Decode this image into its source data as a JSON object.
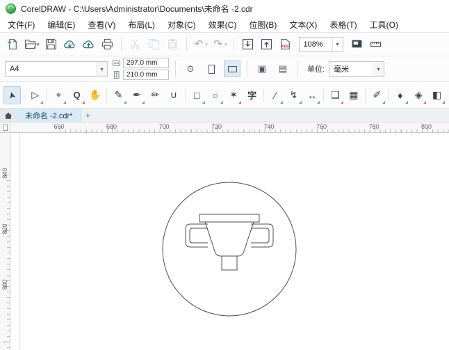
{
  "window": {
    "title": "CorelDRAW - C:\\Users\\Administrator\\Documents\\未命名 -2.cdr"
  },
  "menu": {
    "items": [
      {
        "id": "file",
        "label": "文件(F)"
      },
      {
        "id": "edit",
        "label": "编辑(E)"
      },
      {
        "id": "view",
        "label": "查看(V)"
      },
      {
        "id": "layout",
        "label": "布局(L)"
      },
      {
        "id": "object",
        "label": "对象(C)"
      },
      {
        "id": "effects",
        "label": "效果(C)"
      },
      {
        "id": "bitmaps",
        "label": "位图(B)"
      },
      {
        "id": "text",
        "label": "文本(X)"
      },
      {
        "id": "table",
        "label": "表格(T)"
      },
      {
        "id": "tools",
        "label": "工具(O)"
      }
    ]
  },
  "standard_toolbar": {
    "zoom_level": "108%",
    "buttons": [
      {
        "name": "new-document-button",
        "icon": "new-document-icon"
      },
      {
        "name": "open-document-button",
        "icon": "open-folder-icon",
        "dropdown": true
      },
      {
        "name": "save-button",
        "icon": "save-icon"
      },
      {
        "name": "open-from-cloud-button",
        "icon": "cloud-open-icon"
      },
      {
        "name": "save-to-cloud-button",
        "icon": "cloud-save-icon"
      },
      {
        "name": "print-button",
        "icon": "print-icon"
      },
      {
        "sep": true
      },
      {
        "name": "cut-button",
        "icon": "cut-icon",
        "disabled": true
      },
      {
        "name": "copy-button",
        "icon": "copy-icon",
        "disabled": true
      },
      {
        "name": "paste-button",
        "icon": "paste-icon",
        "disabled": true
      },
      {
        "sep": true
      },
      {
        "name": "undo-button",
        "icon": "undo-icon",
        "dropdown": true,
        "disabled": true
      },
      {
        "name": "redo-button",
        "icon": "redo-icon",
        "dropdown": true,
        "disabled": true
      },
      {
        "sep": true
      },
      {
        "name": "import-button",
        "icon": "import-icon"
      },
      {
        "name": "export-button",
        "icon": "export-icon"
      },
      {
        "name": "publish-pdf-button",
        "icon": "pdf-icon"
      },
      {
        "zoom": true
      },
      {
        "name": "fullscreen-preview-button",
        "icon": "fullscreen-icon"
      },
      {
        "name": "show-rulers-button",
        "icon": "ruler-icon"
      }
    ]
  },
  "property_bar": {
    "page_size": "A4",
    "page_width": "297.0 mm",
    "page_height": "210.0 mm",
    "units_label": "单位:",
    "units_value": "毫米"
  },
  "toolbox": {
    "tools": [
      {
        "name": "pick-tool",
        "glyph": "➤",
        "selected": true
      },
      {
        "sep": true
      },
      {
        "name": "shape-tool",
        "glyph": "▷",
        "flyout": true
      },
      {
        "sep": true
      },
      {
        "name": "crop-tool",
        "glyph": "⌖",
        "flyout": true
      },
      {
        "name": "zoom-tool",
        "glyph": "Q",
        "flyout": true
      },
      {
        "name": "pan-tool",
        "glyph": "✋"
      },
      {
        "sep": true
      },
      {
        "name": "freehand-tool",
        "glyph": "✎",
        "flyout": true
      },
      {
        "name": "bezier-tool",
        "glyph": "✒",
        "flyout": true
      },
      {
        "name": "pen-tool",
        "glyph": "✏"
      },
      {
        "name": "bspline-tool",
        "glyph": "∪"
      },
      {
        "sep": true
      },
      {
        "name": "rectangle-tool",
        "glyph": "□",
        "flyout": true
      },
      {
        "name": "ellipse-tool",
        "glyph": "○",
        "flyout": true
      },
      {
        "name": "polygon-tool",
        "glyph": "✶",
        "flyout": true
      },
      {
        "name": "text-tool",
        "glyph": "字"
      },
      {
        "sep": true
      },
      {
        "name": "line-tool",
        "glyph": "∕",
        "flyout": true
      },
      {
        "name": "connector-tool",
        "glyph": "↯",
        "flyout": true
      },
      {
        "name": "dimension-tool",
        "glyph": "↔",
        "flyout": true
      },
      {
        "sep": true
      },
      {
        "name": "drop-shadow-tool",
        "glyph": "❏",
        "flyout": true
      },
      {
        "name": "transparency-tool",
        "glyph": "▦"
      },
      {
        "sep": true
      },
      {
        "name": "eyedropper-tool",
        "glyph": "✐",
        "flyout": true
      },
      {
        "sep": true
      },
      {
        "name": "outline-pen-tool",
        "glyph": "♦",
        "flyout": true
      },
      {
        "name": "fill-tool",
        "glyph": "◈",
        "flyout": true
      },
      {
        "name": "interactive-fill-tool",
        "glyph": "◧",
        "flyout": true
      }
    ]
  },
  "document_tabs": {
    "active_tab": "未命名 -2.cdr*",
    "new_tab_label": "+"
  },
  "rulers": {
    "horizontal_numbers": [
      "660",
      "680",
      "700",
      "720",
      "740",
      "760",
      "780",
      "800"
    ],
    "vertical_numbers": [
      "840",
      "820",
      "800"
    ]
  },
  "canvas": {
    "shapes": [
      "circle",
      "cup-with-two-handles",
      "base-square"
    ]
  },
  "colors": {
    "accent_blue": "#dcebf7",
    "icon_dark": "#37474f",
    "cloud_teal": "#16717f",
    "logo_green": "#18a038"
  }
}
